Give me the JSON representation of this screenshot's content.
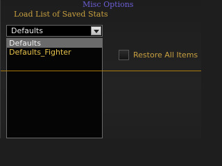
{
  "header": {
    "section_title": "Misc Options",
    "load_label": "Load List of Saved Stats"
  },
  "stats_select": {
    "selected_value": "Defaults",
    "options": [
      "Defaults",
      "Defaults_Fighter"
    ]
  },
  "restore": {
    "label": "Restore All Items",
    "checked": false
  },
  "colors": {
    "accent_gold": "#c8a040",
    "title_purple": "#6b5fd6",
    "divider_gold": "#b8860b"
  }
}
